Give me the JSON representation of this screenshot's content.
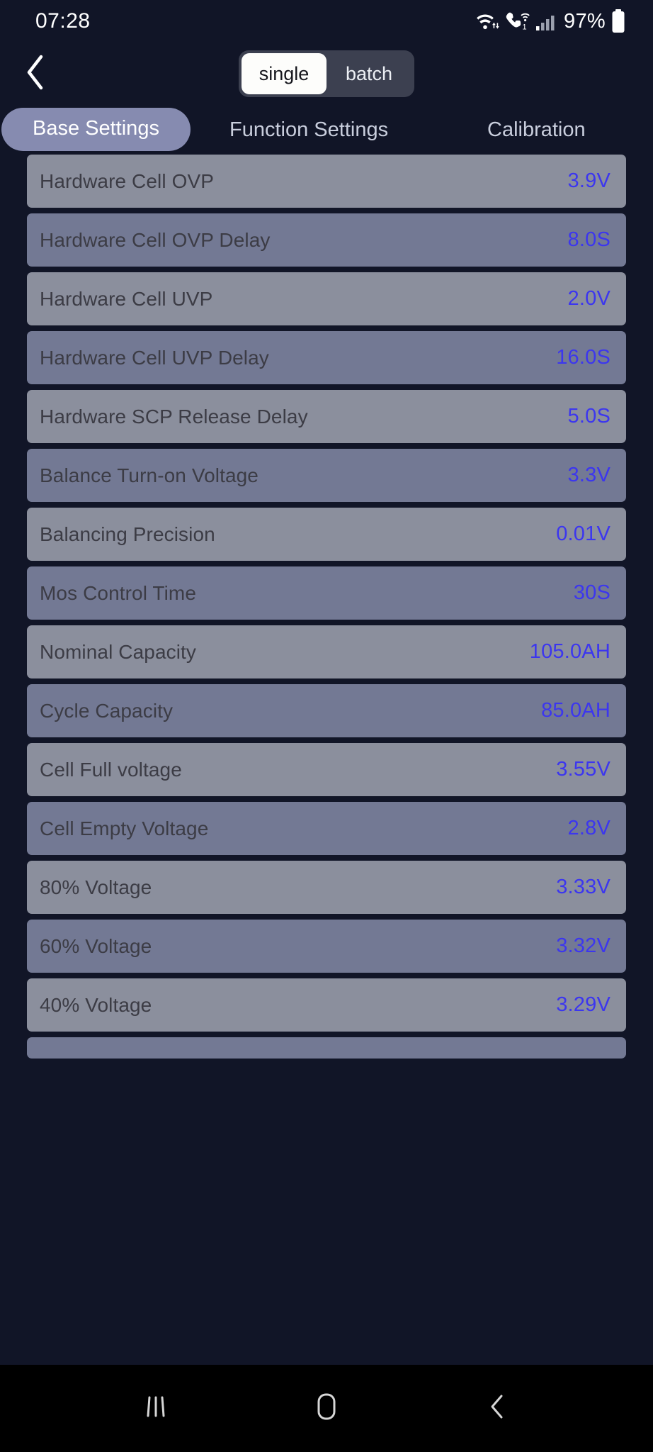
{
  "status_bar": {
    "time": "07:28",
    "battery_percent": "97%",
    "icons": [
      "wifi-data-icon",
      "wifi-calling-icon",
      "cellular-signal-icon",
      "battery-icon"
    ],
    "wifi_calling_badge": "1"
  },
  "topbar": {
    "back_icon": "chevron-left-icon",
    "segmented": {
      "options": [
        "single",
        "batch"
      ],
      "selected": "single"
    }
  },
  "tabs": [
    {
      "label": "Base Settings",
      "active": true
    },
    {
      "label": "Function Settings",
      "active": false
    },
    {
      "label": "Calibration",
      "active": false
    }
  ],
  "settings": [
    {
      "label": "Hardware Cell OVP",
      "value": "3.9V"
    },
    {
      "label": "Hardware Cell OVP Delay",
      "value": "8.0S"
    },
    {
      "label": "Hardware Cell UVP",
      "value": "2.0V"
    },
    {
      "label": "Hardware Cell UVP Delay",
      "value": "16.0S"
    },
    {
      "label": "Hardware SCP Release Delay",
      "value": "5.0S"
    },
    {
      "label": "Balance Turn-on Voltage",
      "value": "3.3V"
    },
    {
      "label": "Balancing Precision",
      "value": "0.01V"
    },
    {
      "label": "Mos Control Time",
      "value": "30S"
    },
    {
      "label": "Nominal Capacity",
      "value": "105.0AH"
    },
    {
      "label": "Cycle Capacity",
      "value": "85.0AH"
    },
    {
      "label": "Cell Full voltage",
      "value": "3.55V"
    },
    {
      "label": "Cell Empty Voltage",
      "value": "2.8V"
    },
    {
      "label": "80% Voltage",
      "value": "3.33V"
    },
    {
      "label": "60% Voltage",
      "value": "3.32V"
    },
    {
      "label": "40% Voltage",
      "value": "3.29V"
    }
  ],
  "navbar": {
    "recents_icon": "recent-apps-icon",
    "home_icon": "home-icon",
    "back_icon": "nav-back-icon"
  },
  "colors": {
    "page_background": "#111527",
    "row_odd": "#8b8f9d",
    "row_even": "#737994",
    "value_text": "#3c36ef",
    "label_text": "#3c3c45",
    "active_tab": "#868bb0",
    "segmented_track": "#3c4050",
    "segmented_active": "#fdfdfb",
    "navbar": "#000000"
  }
}
